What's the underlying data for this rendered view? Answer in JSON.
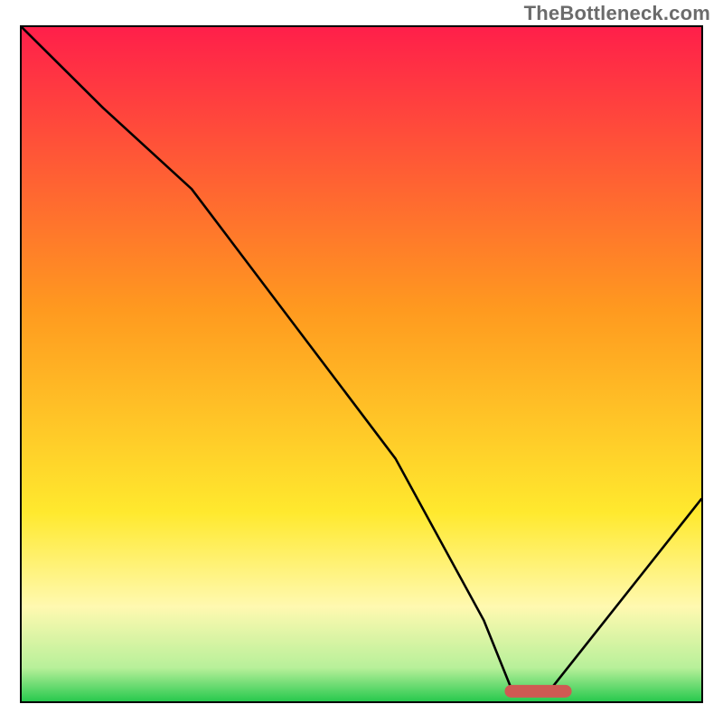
{
  "watermark": "TheBottleneck.com",
  "chart_data": {
    "type": "line",
    "title": "",
    "xlabel": "",
    "ylabel": "",
    "xlim": [
      0,
      100
    ],
    "ylim": [
      0,
      100
    ],
    "grid": false,
    "legend": false,
    "series": [
      {
        "name": "bottleneck-curve",
        "x": [
          0,
          12,
          25,
          40,
          55,
          68,
          72,
          78,
          100
        ],
        "y": [
          100,
          88,
          76,
          56,
          36,
          12,
          2,
          2,
          30
        ]
      }
    ],
    "marker": {
      "name": "optimal-range",
      "x_start": 72,
      "x_end": 80,
      "y": 1.5,
      "color": "#cf5a53"
    },
    "background_gradient": {
      "stops": [
        {
          "pos": 0.0,
          "color": "#ff1f4a"
        },
        {
          "pos": 0.42,
          "color": "#ff9a1f"
        },
        {
          "pos": 0.72,
          "color": "#ffe92e"
        },
        {
          "pos": 0.86,
          "color": "#fff9b0"
        },
        {
          "pos": 0.95,
          "color": "#b8f09a"
        },
        {
          "pos": 1.0,
          "color": "#28c94e"
        }
      ]
    }
  }
}
